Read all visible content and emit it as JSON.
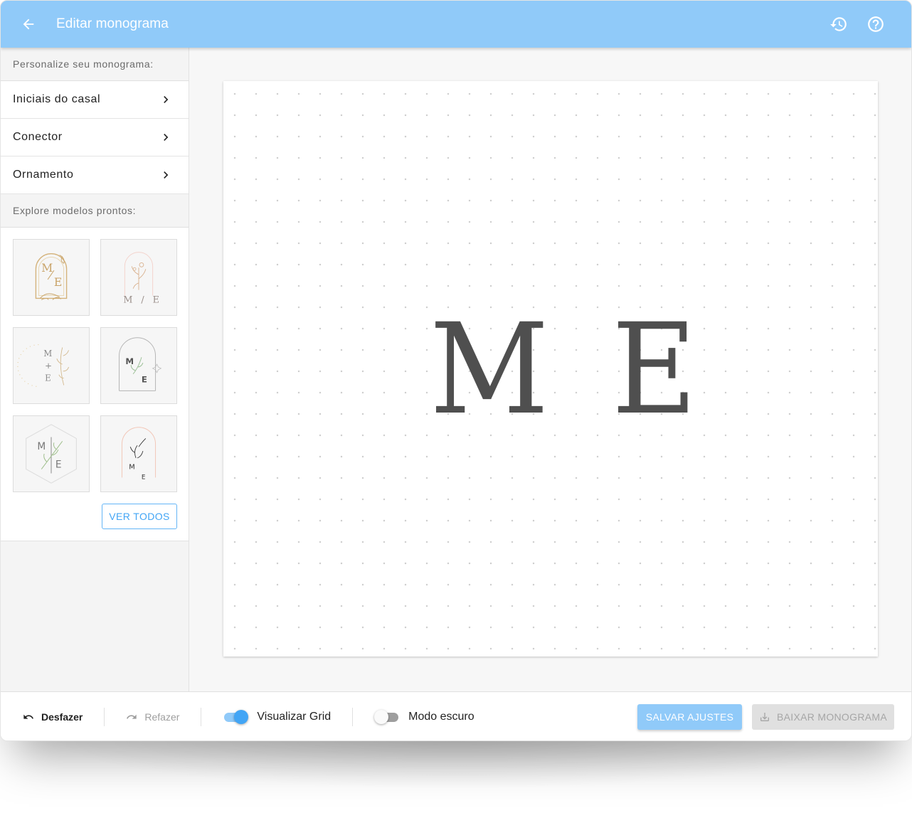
{
  "header": {
    "title": "Editar monograma",
    "back_icon": "arrow-left-icon",
    "history_icon": "history-icon",
    "help_icon": "help-circle-icon",
    "background": "#90caf9"
  },
  "sidebar": {
    "customize_heading": "Personalize seu monograma:",
    "menu": [
      {
        "label": "Iniciais do casal"
      },
      {
        "label": "Conector"
      },
      {
        "label": "Ornamento"
      }
    ],
    "explore_heading": "Explore modelos prontos:",
    "templates": [
      {
        "text": "M / E",
        "style": "gold arch with leaves"
      },
      {
        "text": "M / E",
        "style": "floral arch"
      },
      {
        "text": "M + E",
        "style": "vertical with sprig"
      },
      {
        "text": "M E",
        "style": "arch with branch"
      },
      {
        "text": "M | E",
        "style": "hexagon"
      },
      {
        "text": "M E",
        "style": "arch with floral line art"
      }
    ],
    "view_all_label": "VER TODOS"
  },
  "canvas": {
    "initial_1": "M",
    "initial_2": "E",
    "text_color": "#4f4f4f",
    "grid_visible": true
  },
  "toolbar": {
    "undo_label": "Desfazer",
    "redo_label": "Refazer",
    "grid_toggle_label": "Visualizar Grid",
    "grid_toggle_on": true,
    "dark_mode_label": "Modo escuro",
    "dark_mode_on": false,
    "save_label": "SALVAR AJUSTES",
    "download_label": "BAIXAR MONOGRAMA",
    "accent": "#42a5f5"
  }
}
